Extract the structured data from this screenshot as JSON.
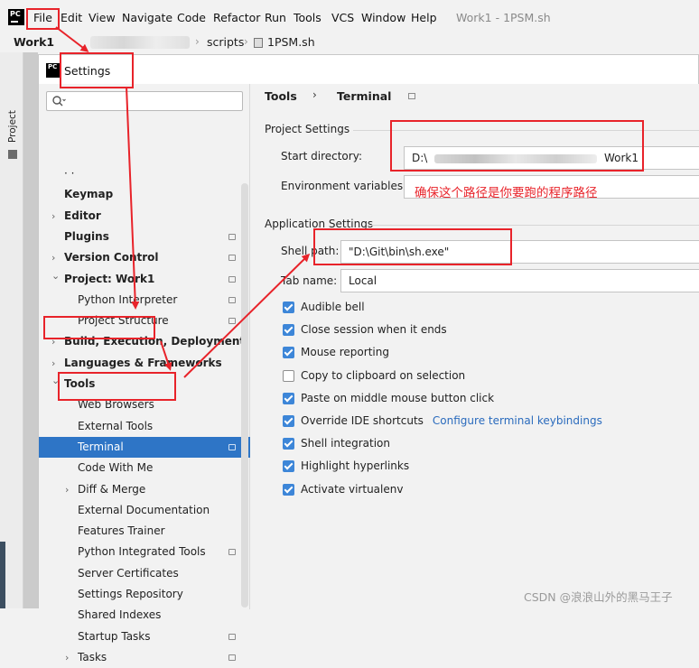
{
  "menubar": {
    "items": [
      "File",
      "Edit",
      "View",
      "Navigate",
      "Code",
      "Refactor",
      "Run",
      "Tools",
      "VCS",
      "Window",
      "Help"
    ],
    "window_title": "Work1 - 1PSM.sh"
  },
  "breadcrumb": {
    "project": "Work1",
    "folder": "scripts",
    "file": "1PSM.sh"
  },
  "toolstrip": {
    "project_label": "Project"
  },
  "dialog": {
    "title": "Settings",
    "search": {
      "placeholder": "",
      "value": ""
    },
    "tree": [
      {
        "label": "· ·",
        "bold": false,
        "indent": 1,
        "chevron": false,
        "gear": false
      },
      {
        "label": "Keymap",
        "bold": true,
        "indent": 1,
        "chevron": false,
        "gear": false
      },
      {
        "label": "Editor",
        "bold": true,
        "indent": 1,
        "chevron": true,
        "gear": false
      },
      {
        "label": "Plugins",
        "bold": true,
        "indent": 1,
        "chevron": false,
        "gear": true
      },
      {
        "label": "Version Control",
        "bold": true,
        "indent": 1,
        "chevron": true,
        "gear": true
      },
      {
        "label": "Project: Work1",
        "bold": true,
        "indent": 1,
        "chevron": "open",
        "gear": true
      },
      {
        "label": "Python Interpreter",
        "bold": false,
        "indent": 2,
        "chevron": false,
        "gear": true
      },
      {
        "label": "Project Structure",
        "bold": false,
        "indent": 2,
        "chevron": false,
        "gear": true
      },
      {
        "label": "Build, Execution, Deployment",
        "bold": true,
        "indent": 1,
        "chevron": true,
        "gear": false
      },
      {
        "label": "Languages & Frameworks",
        "bold": true,
        "indent": 1,
        "chevron": true,
        "gear": false
      },
      {
        "label": "Tools",
        "bold": true,
        "indent": 1,
        "chevron": "open",
        "gear": false
      },
      {
        "label": "Web Browsers",
        "bold": false,
        "indent": 2,
        "chevron": false,
        "gear": false
      },
      {
        "label": "External Tools",
        "bold": false,
        "indent": 2,
        "chevron": false,
        "gear": false
      },
      {
        "label": "Terminal",
        "bold": false,
        "indent": 2,
        "chevron": false,
        "gear": true,
        "selected": true
      },
      {
        "label": "Code With Me",
        "bold": false,
        "indent": 2,
        "chevron": false,
        "gear": false
      },
      {
        "label": "Diff & Merge",
        "bold": false,
        "indent": 2,
        "chevron": true,
        "gear": false
      },
      {
        "label": "External Documentation",
        "bold": false,
        "indent": 2,
        "chevron": false,
        "gear": false
      },
      {
        "label": "Features Trainer",
        "bold": false,
        "indent": 2,
        "chevron": false,
        "gear": false
      },
      {
        "label": "Python Integrated Tools",
        "bold": false,
        "indent": 2,
        "chevron": false,
        "gear": true
      },
      {
        "label": "Server Certificates",
        "bold": false,
        "indent": 2,
        "chevron": false,
        "gear": false
      },
      {
        "label": "Settings Repository",
        "bold": false,
        "indent": 2,
        "chevron": false,
        "gear": false
      },
      {
        "label": "Shared Indexes",
        "bold": false,
        "indent": 2,
        "chevron": false,
        "gear": false
      },
      {
        "label": "Startup Tasks",
        "bold": false,
        "indent": 2,
        "chevron": false,
        "gear": true
      },
      {
        "label": "Tasks",
        "bold": false,
        "indent": 2,
        "chevron": true,
        "gear": true
      }
    ],
    "content": {
      "breadcrumb_tools": "Tools",
      "breadcrumb_sep": "›",
      "breadcrumb_terminal": "Terminal",
      "project_settings_title": "Project Settings",
      "start_directory_label": "Start directory:",
      "start_directory_prefix": "D:\\",
      "start_directory_suffix": "Work1",
      "env_vars_label": "Environment variables:",
      "env_vars_value": "",
      "app_settings_title": "Application Settings",
      "shell_path_label": "Shell path:",
      "shell_path_value": "\"D:\\Git\\bin\\sh.exe\"",
      "tab_name_label": "Tab name:",
      "tab_name_value": "Local",
      "checkboxes": [
        {
          "label": "Audible bell",
          "checked": true
        },
        {
          "label": "Close session when it ends",
          "checked": true
        },
        {
          "label": "Mouse reporting",
          "checked": true
        },
        {
          "label": "Copy to clipboard on selection",
          "checked": false
        },
        {
          "label": "Paste on middle mouse button click",
          "checked": true
        },
        {
          "label": "Override IDE shortcuts",
          "checked": true,
          "link": "Configure terminal keybindings"
        },
        {
          "label": "Shell integration",
          "checked": true
        },
        {
          "label": "Highlight hyperlinks",
          "checked": true
        },
        {
          "label": "Activate virtualenv",
          "checked": true
        }
      ]
    }
  },
  "annotation": {
    "note": "确保这个路径是你要跑的程序路径",
    "color": "#e8232a"
  },
  "watermark": "CSDN @浪浪山外的黑马王子",
  "colors": {
    "selection": "#2e75c6",
    "checkbox": "#3d86d8",
    "link": "#2a6bbd"
  }
}
